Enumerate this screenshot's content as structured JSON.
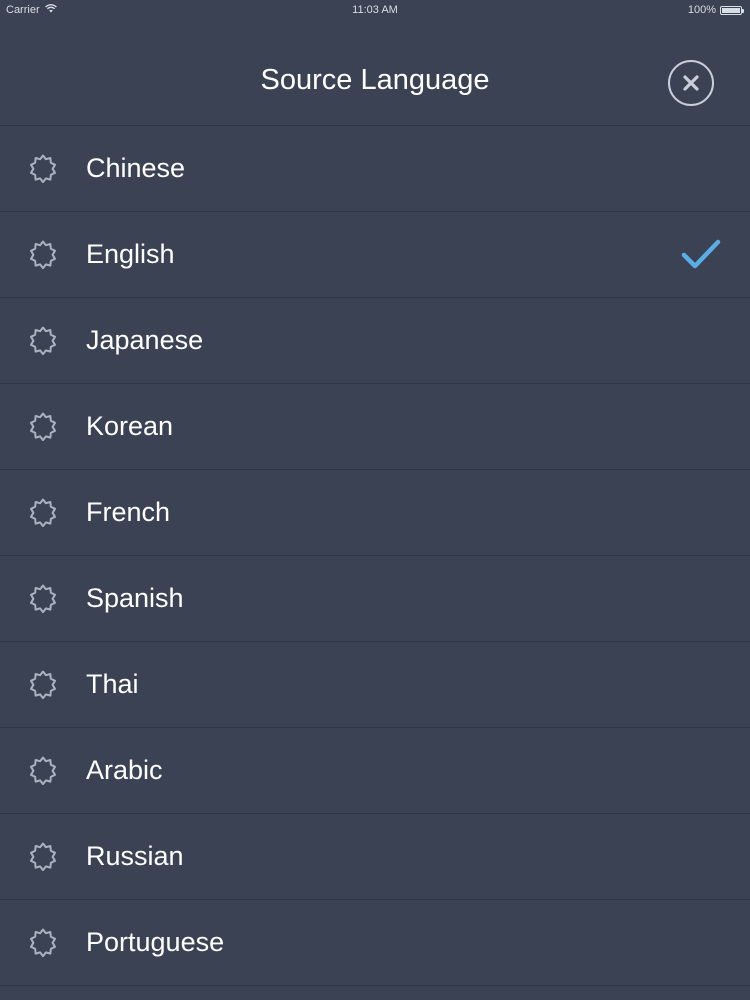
{
  "status_bar": {
    "carrier": "Carrier",
    "time": "11:03 AM",
    "battery": "100%"
  },
  "header": {
    "title": "Source Language"
  },
  "languages": [
    {
      "label": "Chinese",
      "selected": false
    },
    {
      "label": "English",
      "selected": true
    },
    {
      "label": "Japanese",
      "selected": false
    },
    {
      "label": "Korean",
      "selected": false
    },
    {
      "label": "French",
      "selected": false
    },
    {
      "label": "Spanish",
      "selected": false
    },
    {
      "label": "Thai",
      "selected": false
    },
    {
      "label": "Arabic",
      "selected": false
    },
    {
      "label": "Russian",
      "selected": false
    },
    {
      "label": "Portuguese",
      "selected": false
    }
  ],
  "colors": {
    "background": "#3a4253",
    "divider": "#2e3543",
    "checkmark": "#5aaee6",
    "icon": "#aab2bf"
  },
  "icons": {
    "row_icon": "badge-icon",
    "selected_icon": "checkmark-icon",
    "close_icon": "close-icon"
  }
}
